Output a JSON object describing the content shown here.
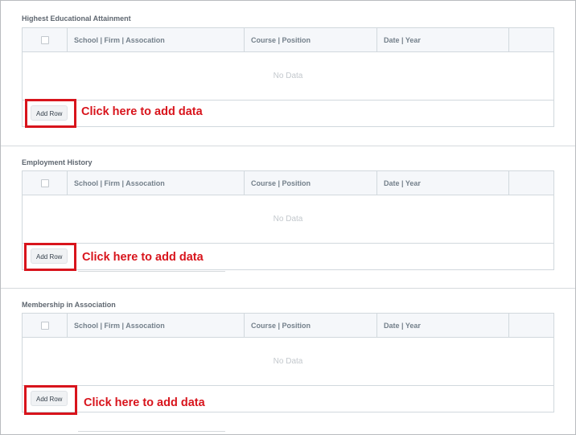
{
  "columns": {
    "school": "School | Firm | Assocation",
    "course": "Course | Position",
    "date": "Date | Year"
  },
  "empty_text": "No Data",
  "add_row_label": "Add Row",
  "annotation_text": "Click here to add data",
  "annotation_color": "#d8141c",
  "sections": [
    {
      "title": "Highest Educational Attainment"
    },
    {
      "title": "Employment History"
    },
    {
      "title": "Membership in Association"
    }
  ]
}
